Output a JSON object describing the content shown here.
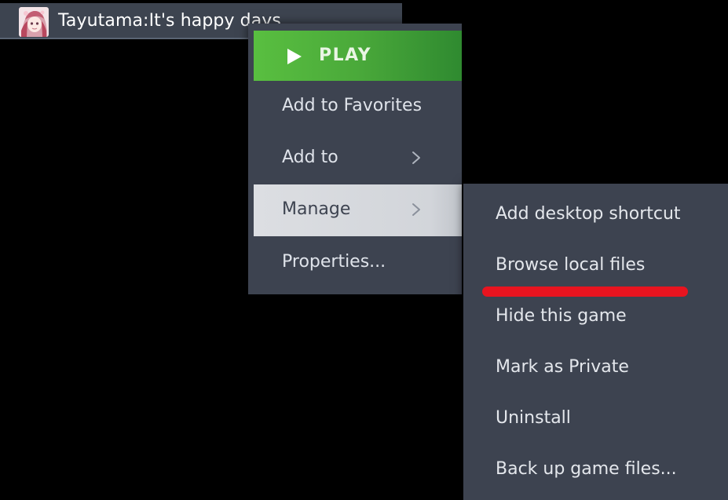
{
  "game": {
    "title": "Tayutama:It's happy days",
    "thumbnail_icon": "game-cover-thumbnail"
  },
  "context_menu": {
    "play_label": "PLAY",
    "items": [
      {
        "label": "Add to Favorites",
        "has_submenu": false
      },
      {
        "label": "Add to",
        "has_submenu": true
      },
      {
        "label": "Manage",
        "has_submenu": true,
        "active": true
      },
      {
        "label": "Properties..."
      }
    ]
  },
  "manage_submenu": {
    "items": [
      {
        "label": "Add desktop shortcut"
      },
      {
        "label": "Browse local files",
        "highlighted": true
      },
      {
        "label": "Hide this game"
      },
      {
        "label": "Mark as Private"
      },
      {
        "label": "Uninstall"
      },
      {
        "label": "Back up game files..."
      }
    ]
  },
  "colors": {
    "menu_bg": "#3d4350",
    "play_green": "#59bf40",
    "active_item_bg": "#dcdee2",
    "annotation_red": "#e8141f"
  }
}
